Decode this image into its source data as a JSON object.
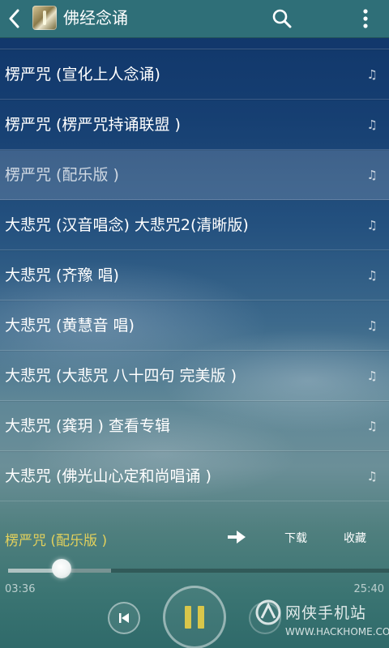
{
  "header": {
    "title": "佛经念诵",
    "icons": [
      "back-icon",
      "app-logo",
      "search-icon",
      "more-icon"
    ]
  },
  "playlist": {
    "items": [
      {
        "title": "楞严咒 (宣化上人念诵)"
      },
      {
        "title": "楞严咒 (楞严咒持诵联盟 )"
      },
      {
        "title": "楞严咒 (配乐版 )",
        "selected": true
      },
      {
        "title": "大悲咒 (汉音唱念) 大悲咒2(清晰版)"
      },
      {
        "title": "大悲咒 (齐豫 唱)"
      },
      {
        "title": "大悲咒 (黄慧音 唱)"
      },
      {
        "title": "大悲咒 (大悲咒 八十四句 完美版 )"
      },
      {
        "title": "大悲咒 (龚玥 ) 查看专辑"
      },
      {
        "title": "大悲咒 (佛光山心定和尚唱诵 )"
      }
    ],
    "item_icon": "♫"
  },
  "now_playing": {
    "title": "楞严咒 (配乐版 )",
    "download_label": "下载",
    "favorite_label": "收藏"
  },
  "progress": {
    "elapsed": "03:36",
    "total": "25:40",
    "played_fraction": 0.14,
    "buffered_fraction": 0.27
  },
  "controls": {
    "state": "playing"
  },
  "watermark": {
    "name": "网侠手机站",
    "url": "WWW.HACKHOME.COM"
  },
  "colors": {
    "accent": "#d9c64a",
    "now_playing_title": "#e2d05c",
    "topbar": "#2f6f78"
  }
}
